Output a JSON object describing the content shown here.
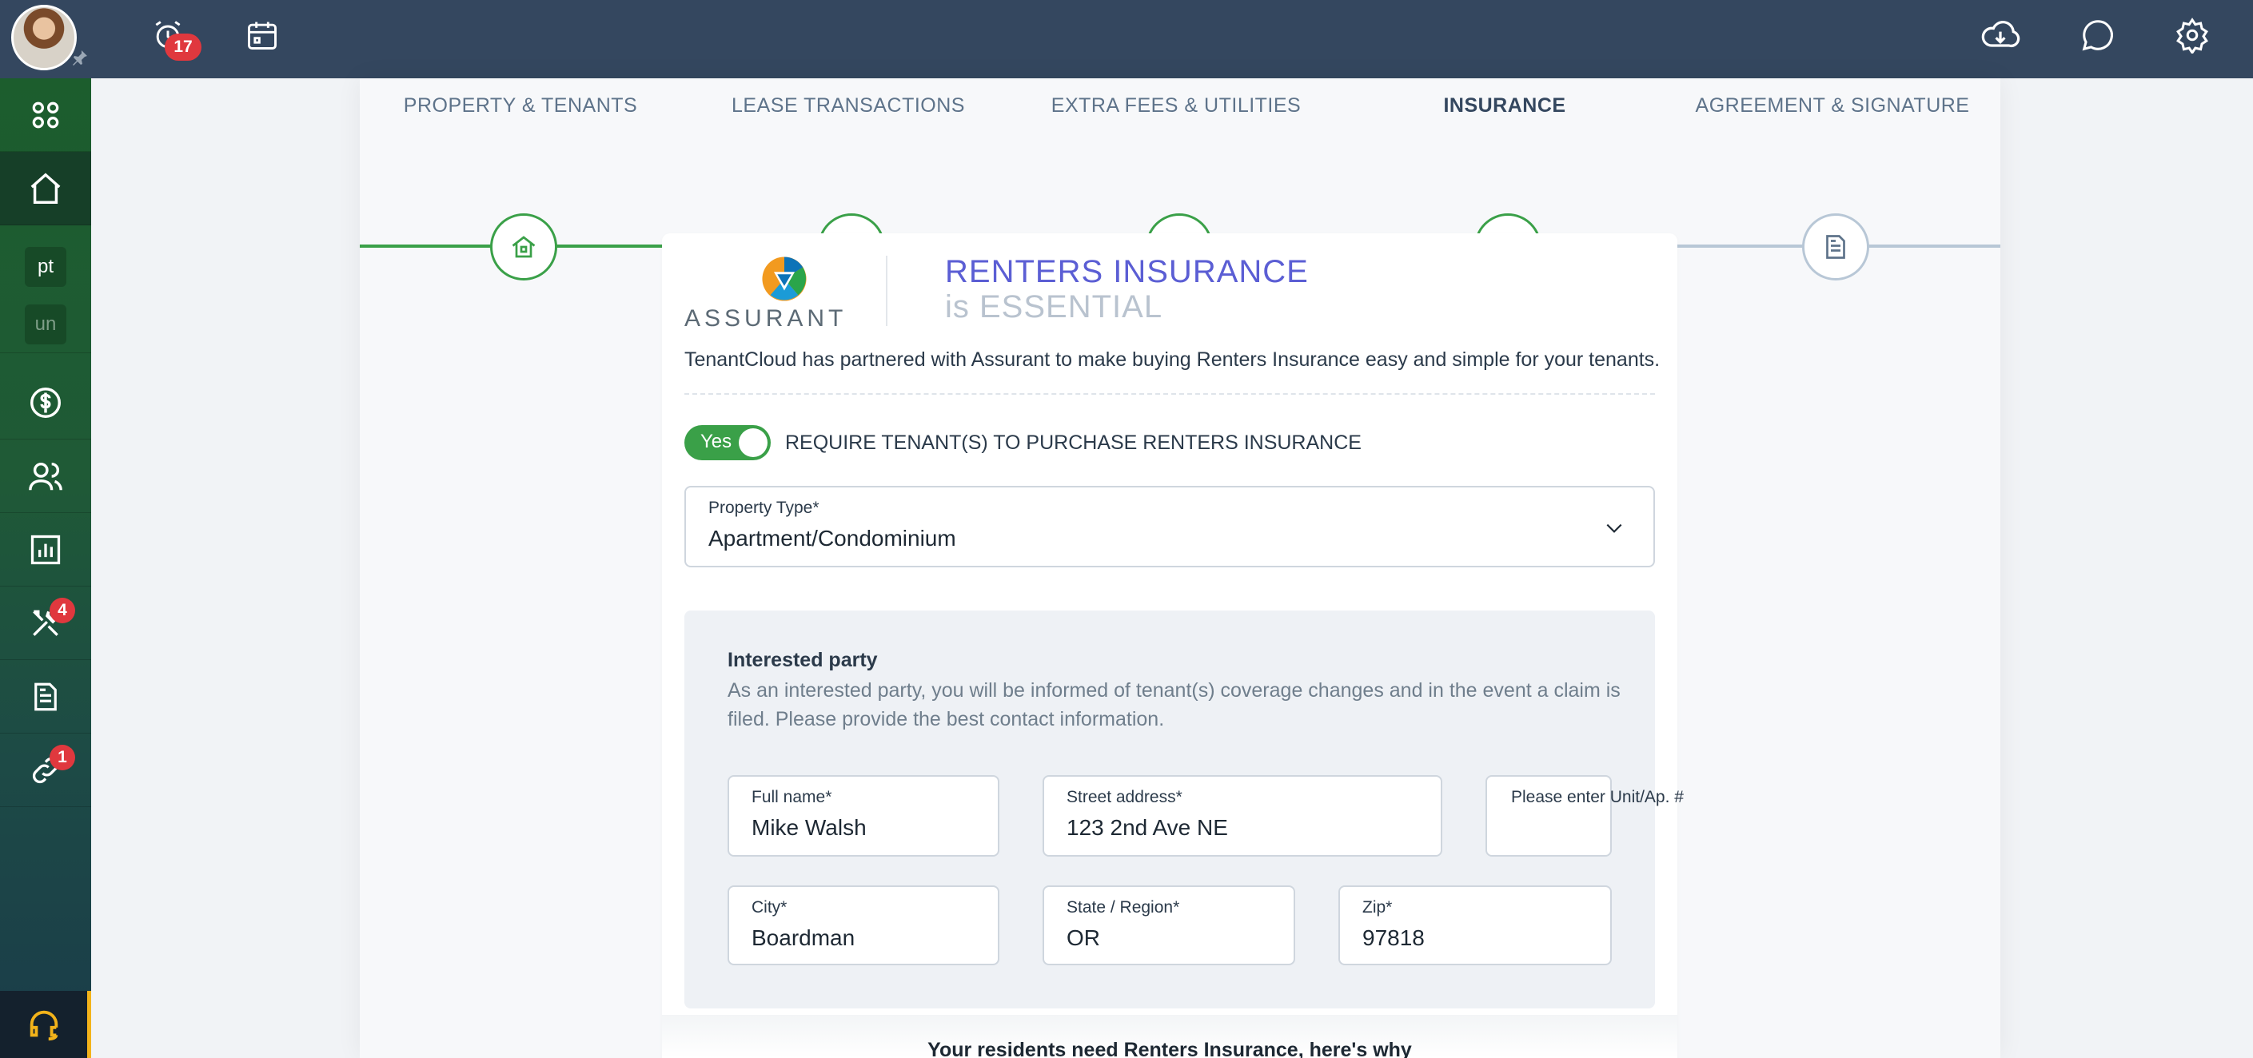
{
  "topbar": {
    "notifications_badge": "17",
    "icons": [
      "avatar",
      "pin-icon",
      "alarm-clock-icon",
      "calendar-icon",
      "download-cloud-icon",
      "chat-icon",
      "gear-icon"
    ]
  },
  "sidebar": {
    "items": [
      {
        "icon": "apps-grid-icon"
      },
      {
        "icon": "home-icon"
      },
      {
        "label": "pt"
      },
      {
        "label": "un"
      },
      {
        "icon": "dollar-icon"
      },
      {
        "icon": "people-icon"
      },
      {
        "icon": "chart-icon"
      },
      {
        "icon": "tools-icon",
        "badge": "4"
      },
      {
        "icon": "document-icon"
      },
      {
        "icon": "link-icon",
        "badge": "1"
      }
    ],
    "support_icon": "headset-icon"
  },
  "steps": [
    {
      "label": "PROPERTY & TENANTS",
      "status": "done",
      "icon": "house-icon"
    },
    {
      "label": "LEASE TRANSACTIONS",
      "status": "done",
      "icon": "dollar-circle-icon"
    },
    {
      "label": "EXTRA FEES & UTILITIES",
      "status": "done",
      "icon": "bills-icon"
    },
    {
      "label": "INSURANCE",
      "status": "active",
      "icon": "shield-check-icon"
    },
    {
      "label": "AGREEMENT & SIGNATURE",
      "status": "todo",
      "icon": "contract-icon"
    }
  ],
  "insurance": {
    "brand": "ASSURANT",
    "title": "RENTERS INSURANCE",
    "subtitle": "is ESSENTIAL",
    "partner_text": "TenantCloud has partnered with Assurant to make buying Renters Insurance easy and simple for your tenants.",
    "toggle_label": "Yes",
    "require_label": "REQUIRE TENANT(S) TO PURCHASE RENTERS INSURANCE",
    "property_type": {
      "label": "Property Type*",
      "value": "Apartment/Condominium"
    },
    "interested_party": {
      "title": "Interested party",
      "description": "As an interested party, you will be informed of tenant(s) coverage changes and in the event a claim is filed. Please provide the best contact information.",
      "full_name": {
        "label": "Full name*",
        "value": "Mike Walsh"
      },
      "street": {
        "label": "Street address*",
        "value": "123 2nd Ave NE"
      },
      "unit": {
        "placeholder": "Please enter Unit/Ap. #",
        "value": ""
      },
      "city": {
        "label": "City*",
        "value": "Boardman"
      },
      "state": {
        "label": "State / Region*",
        "value": "OR"
      },
      "zip": {
        "label": "Zip*",
        "value": "97818"
      }
    },
    "why_heading": "Your residents need Renters Insurance, here's why"
  },
  "colors": {
    "topbar": "#34475f",
    "sidebar_top": "#1c5d2d",
    "progress_done": "#3aa048",
    "progress_todo": "#b8c7d6",
    "accent_purple": "#5b5ed4",
    "badge_red": "#e0383e",
    "support_accent": "#f3b31a"
  }
}
